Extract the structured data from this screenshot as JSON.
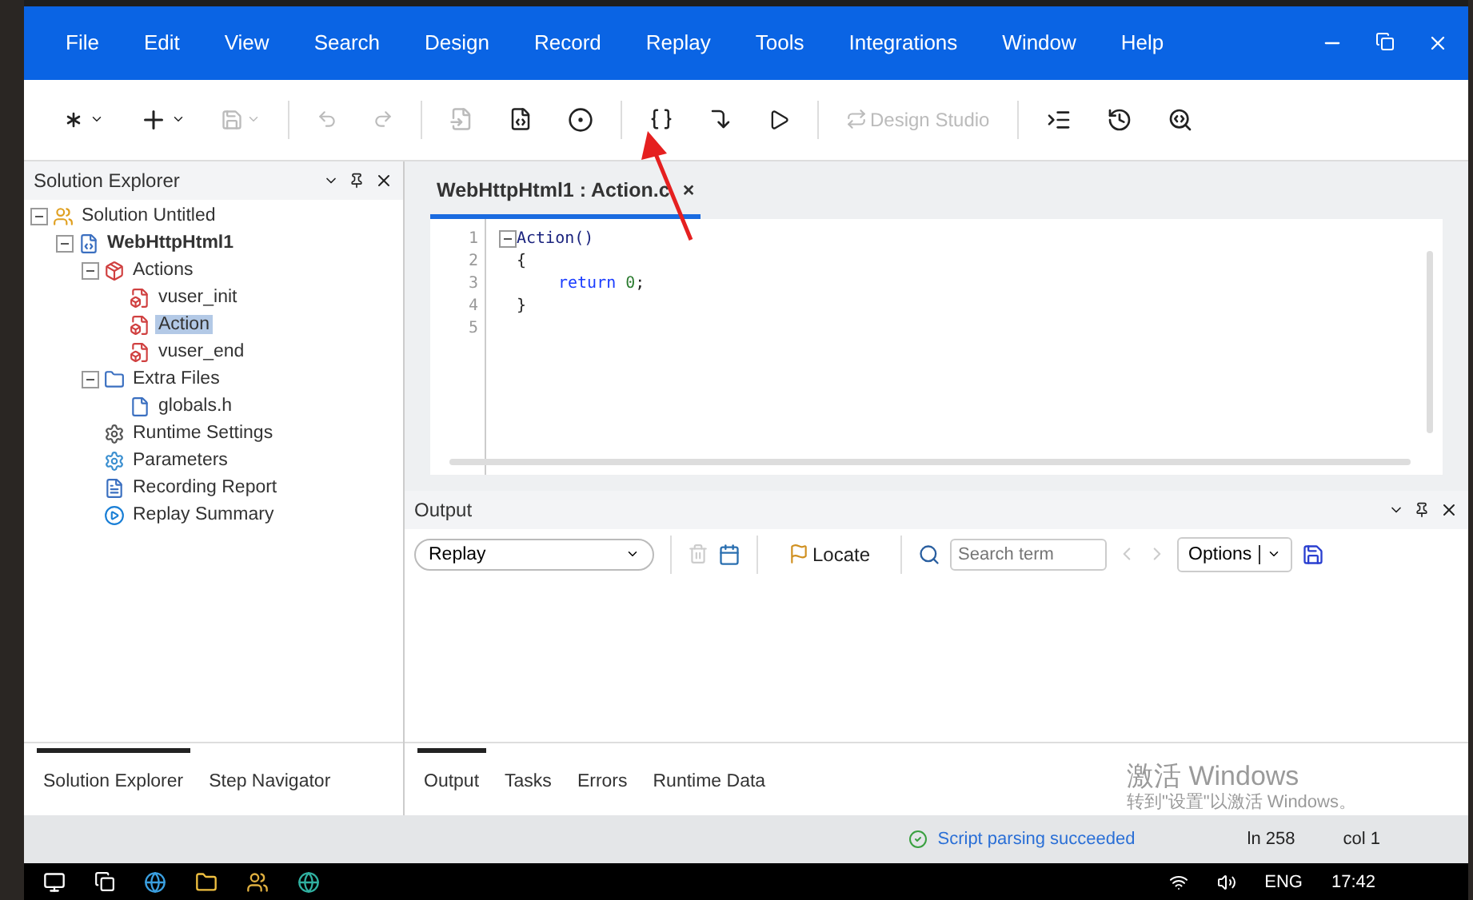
{
  "menu": [
    "File",
    "Edit",
    "View",
    "Search",
    "Design",
    "Record",
    "Replay",
    "Tools",
    "Integrations",
    "Window",
    "Help"
  ],
  "toolbar": {
    "design_studio": "Design Studio"
  },
  "solution_explorer": {
    "title": "Solution Explorer",
    "tree": [
      {
        "label": "Solution Untitled",
        "kind": "solution",
        "expanded": true,
        "selected": false,
        "children": [
          {
            "label": "WebHttpHtml1",
            "kind": "script",
            "expanded": true,
            "selected": false,
            "children": [
              {
                "label": "Actions",
                "kind": "actions",
                "expanded": true,
                "selected": false,
                "children": [
                  {
                    "label": "vuser_init",
                    "kind": "action",
                    "selected": false
                  },
                  {
                    "label": "Action",
                    "kind": "action",
                    "selected": true
                  },
                  {
                    "label": "vuser_end",
                    "kind": "action",
                    "selected": false
                  }
                ]
              },
              {
                "label": "Extra Files",
                "kind": "files",
                "expanded": true,
                "selected": false,
                "children": [
                  {
                    "label": "globals.h",
                    "kind": "file",
                    "selected": false
                  }
                ]
              },
              {
                "label": "Runtime Settings",
                "kind": "settings",
                "selected": false
              },
              {
                "label": "Parameters",
                "kind": "params",
                "selected": false
              },
              {
                "label": "Recording Report",
                "kind": "report",
                "selected": false
              },
              {
                "label": "Replay Summary",
                "kind": "summary",
                "selected": false
              }
            ]
          }
        ]
      }
    ],
    "tabs": [
      {
        "label": "Solution Explorer",
        "selected": true
      },
      {
        "label": "Step Navigator",
        "selected": false
      }
    ]
  },
  "editor": {
    "tab": "WebHttpHtml1 : Action.c",
    "close": "×",
    "lines": [
      {
        "number": "1",
        "fold": true,
        "indent": false,
        "tokens": [
          {
            "kind": "func",
            "text": "Action()"
          }
        ]
      },
      {
        "number": "2",
        "fold": false,
        "indent": false,
        "tokens": [
          {
            "kind": "plain",
            "text": "{"
          }
        ]
      },
      {
        "number": "3",
        "fold": false,
        "indent": true,
        "tokens": [
          {
            "kind": "keyword",
            "text": "return"
          },
          {
            "kind": "number",
            "text": "0"
          },
          {
            "kind": "plain",
            "text": ";"
          }
        ]
      },
      {
        "number": "4",
        "fold": false,
        "indent": false,
        "tokens": [
          {
            "kind": "plain",
            "text": "}"
          }
        ]
      },
      {
        "number": "5",
        "fold": false
      }
    ]
  },
  "output": {
    "title": "Output",
    "source": "Replay",
    "locate": "Locate",
    "search": {
      "placeholder": "Search term"
    },
    "options": "Options",
    "tabs": [
      {
        "label": "Output",
        "selected": true
      },
      {
        "label": "Tasks",
        "selected": false
      },
      {
        "label": "Errors",
        "selected": false
      },
      {
        "label": "Runtime Data",
        "selected": false
      }
    ]
  },
  "activation": {
    "title": "激活 Windows",
    "hint": "转到\"设置\"以激活 Windows。"
  },
  "status_bar": {
    "message": "Script parsing succeeded",
    "line": "ln 258",
    "column": "col 1"
  },
  "taskbar": {
    "language": "ENG",
    "time": "17:42"
  }
}
